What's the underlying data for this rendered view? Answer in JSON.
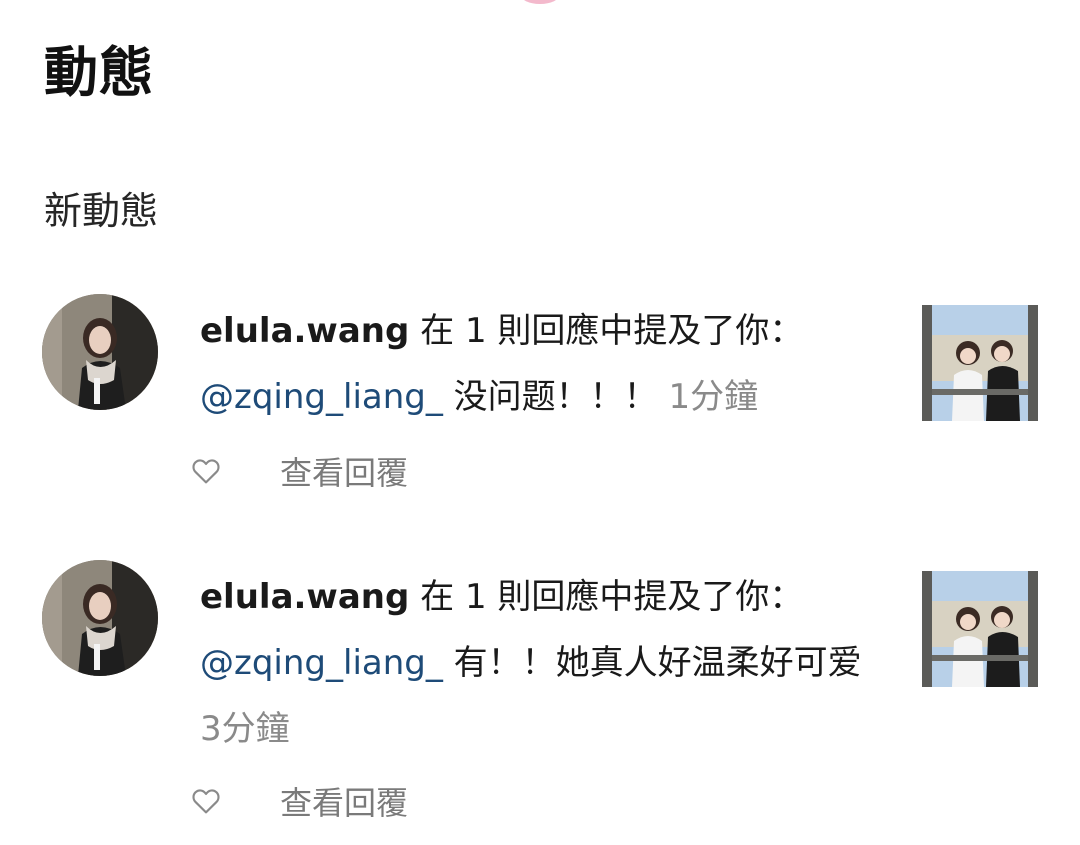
{
  "header": {
    "title": "動態",
    "section_title": "新動態"
  },
  "notifications": [
    {
      "username": "elula.wang",
      "action_text": " 在 1 則回應中提及了你：",
      "mention": "@zqing_liang_",
      "comment": " 没问题！！！ ",
      "timestamp": "1分鐘",
      "like_icon": "heart-outline-icon",
      "view_replies_label": "查看回覆"
    },
    {
      "username": "elula.wang",
      "action_text": " 在 1 則回應中提及了你：",
      "mention": "@zqing_liang_",
      "comment": " 有！！她真人好温柔好可爱 ",
      "timestamp": "3分鐘",
      "like_icon": "heart-outline-icon",
      "view_replies_label": "查看回覆"
    }
  ],
  "colors": {
    "mention": "#1e4b78",
    "timestamp": "#8a8a8a",
    "secondary_text": "#7a7a7a"
  }
}
